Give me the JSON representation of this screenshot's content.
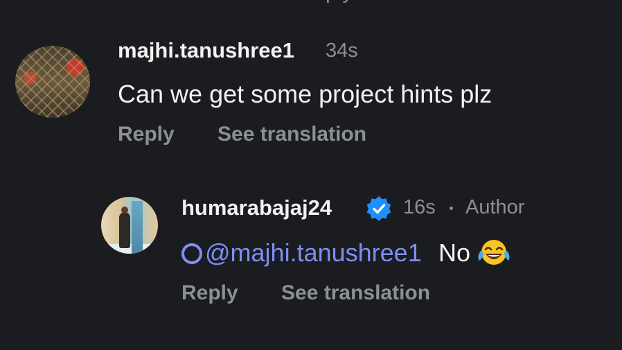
{
  "top_partial_text": "ply",
  "comments": [
    {
      "username": "majhi.tanushree1",
      "time": "34s",
      "text": "Can we get some project hints plz",
      "actions": {
        "reply": "Reply",
        "translate": "See translation"
      }
    },
    {
      "username": "humarabajaj24",
      "verified": true,
      "time": "16s",
      "author_badge": "Author",
      "mention": "@majhi.tanushree1",
      "text": "No",
      "emoji": "face-with-tears-of-joy",
      "actions": {
        "reply": "Reply",
        "translate": "See translation"
      }
    }
  ],
  "colors": {
    "background": "#1b1c1f",
    "primary_text": "#f2f2f2",
    "secondary_text": "#8d8f96",
    "mention": "#7e8ef4",
    "verified": "#1e90ff"
  }
}
